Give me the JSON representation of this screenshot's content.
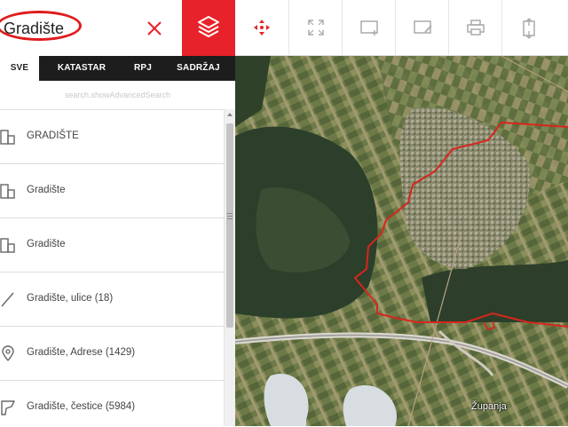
{
  "search": {
    "query": "Gradište",
    "placeholder": ""
  },
  "toolbar": {
    "buttons": [
      {
        "name": "pan-move",
        "icon": "move-arrows-icon"
      },
      {
        "name": "fullscreen",
        "icon": "fullscreen-icon"
      },
      {
        "name": "add-area",
        "icon": "add-rectangle-icon"
      },
      {
        "name": "edit-area",
        "icon": "edit-rectangle-icon"
      },
      {
        "name": "print",
        "icon": "print-icon"
      },
      {
        "name": "export",
        "icon": "export-icon"
      }
    ]
  },
  "tabs": [
    {
      "label": "SVE",
      "active": true
    },
    {
      "label": "KATASTAR",
      "active": false
    },
    {
      "label": "RPJ",
      "active": false
    },
    {
      "label": "SADRŽAJ",
      "active": false
    }
  ],
  "advanced_search": "search.showAdvancedSearch",
  "results": [
    {
      "label": "GRADIŠTE",
      "icon": "building-icon"
    },
    {
      "label": "Gradište",
      "icon": "building-icon"
    },
    {
      "label": "Gradište",
      "icon": "building-icon"
    },
    {
      "label": "Gradište, ulice (18)",
      "icon": "street-line-icon"
    },
    {
      "label": "Gradište, Adrese (1429)",
      "icon": "location-pin-icon"
    },
    {
      "label": "Gradište, čestice (5984)",
      "icon": "parcel-icon"
    }
  ],
  "map": {
    "place_label": "Županja",
    "boundary_color": "#d7261e"
  },
  "colors": {
    "accent": "#e8222a",
    "tab_bar": "#1d1d1d",
    "highlight_circle": "#e01c1c"
  }
}
